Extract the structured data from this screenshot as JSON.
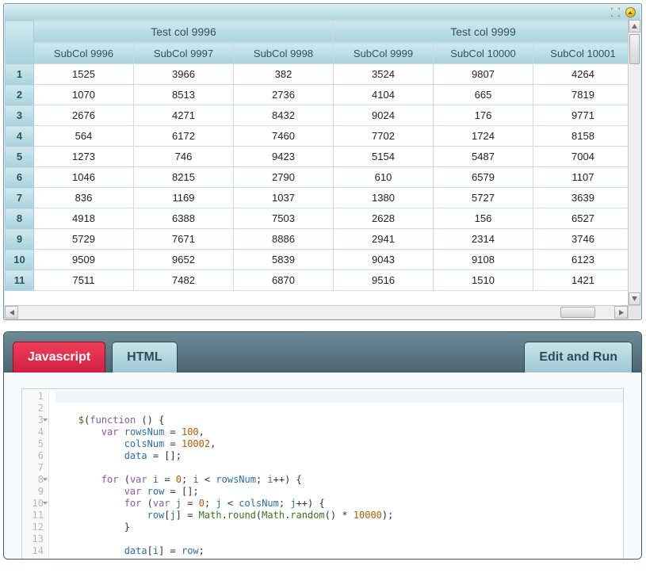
{
  "toolbar": {
    "expand_icon": "expand-icon",
    "collapse_icon": "collapse-icon"
  },
  "grid": {
    "groups": [
      {
        "label": "Test col 9996",
        "span": 3
      },
      {
        "label": "Test col 9999",
        "span": 3
      }
    ],
    "columns": [
      "SubCol 9996",
      "SubCol 9997",
      "SubCol 9998",
      "SubCol 9999",
      "SubCol 10000",
      "SubCol 10001"
    ],
    "row_headers": [
      "1",
      "2",
      "3",
      "4",
      "5",
      "6",
      "7",
      "8",
      "9",
      "10",
      "11"
    ],
    "rows": [
      [
        1525,
        3966,
        382,
        3524,
        9807,
        4264
      ],
      [
        1070,
        8513,
        2736,
        4104,
        665,
        7819
      ],
      [
        2676,
        4271,
        8432,
        9024,
        176,
        9771
      ],
      [
        564,
        6172,
        7460,
        7702,
        1724,
        8158
      ],
      [
        1273,
        746,
        9423,
        5154,
        5487,
        7004
      ],
      [
        1046,
        8215,
        2790,
        610,
        6579,
        1107
      ],
      [
        836,
        1169,
        1037,
        1380,
        5727,
        3639
      ],
      [
        4918,
        6388,
        7503,
        2628,
        156,
        6527
      ],
      [
        5729,
        7671,
        8886,
        2941,
        2314,
        3746
      ],
      [
        9509,
        9652,
        5839,
        9043,
        9108,
        6123
      ],
      [
        7511,
        7482,
        6870,
        9516,
        1510,
        1421
      ]
    ]
  },
  "tabs": {
    "items": [
      {
        "label": "Javascript",
        "active": true
      },
      {
        "label": "HTML",
        "active": false
      }
    ],
    "run_label": "Edit and Run"
  },
  "code": {
    "lines": [
      "",
      "",
      "    $(function () {",
      "        var rowsNum = 100,",
      "            colsNum = 10002,",
      "            data = [];",
      "",
      "        for (var i = 0; i < rowsNum; i++) {",
      "            var row = [];",
      "            for (var j = 0; j < colsNum; j++) {",
      "                row[j] = Math.round(Math.random() * 10000);",
      "            }",
      "",
      "            data[i] = row;"
    ],
    "fold_lines": [
      3,
      8,
      10
    ]
  }
}
